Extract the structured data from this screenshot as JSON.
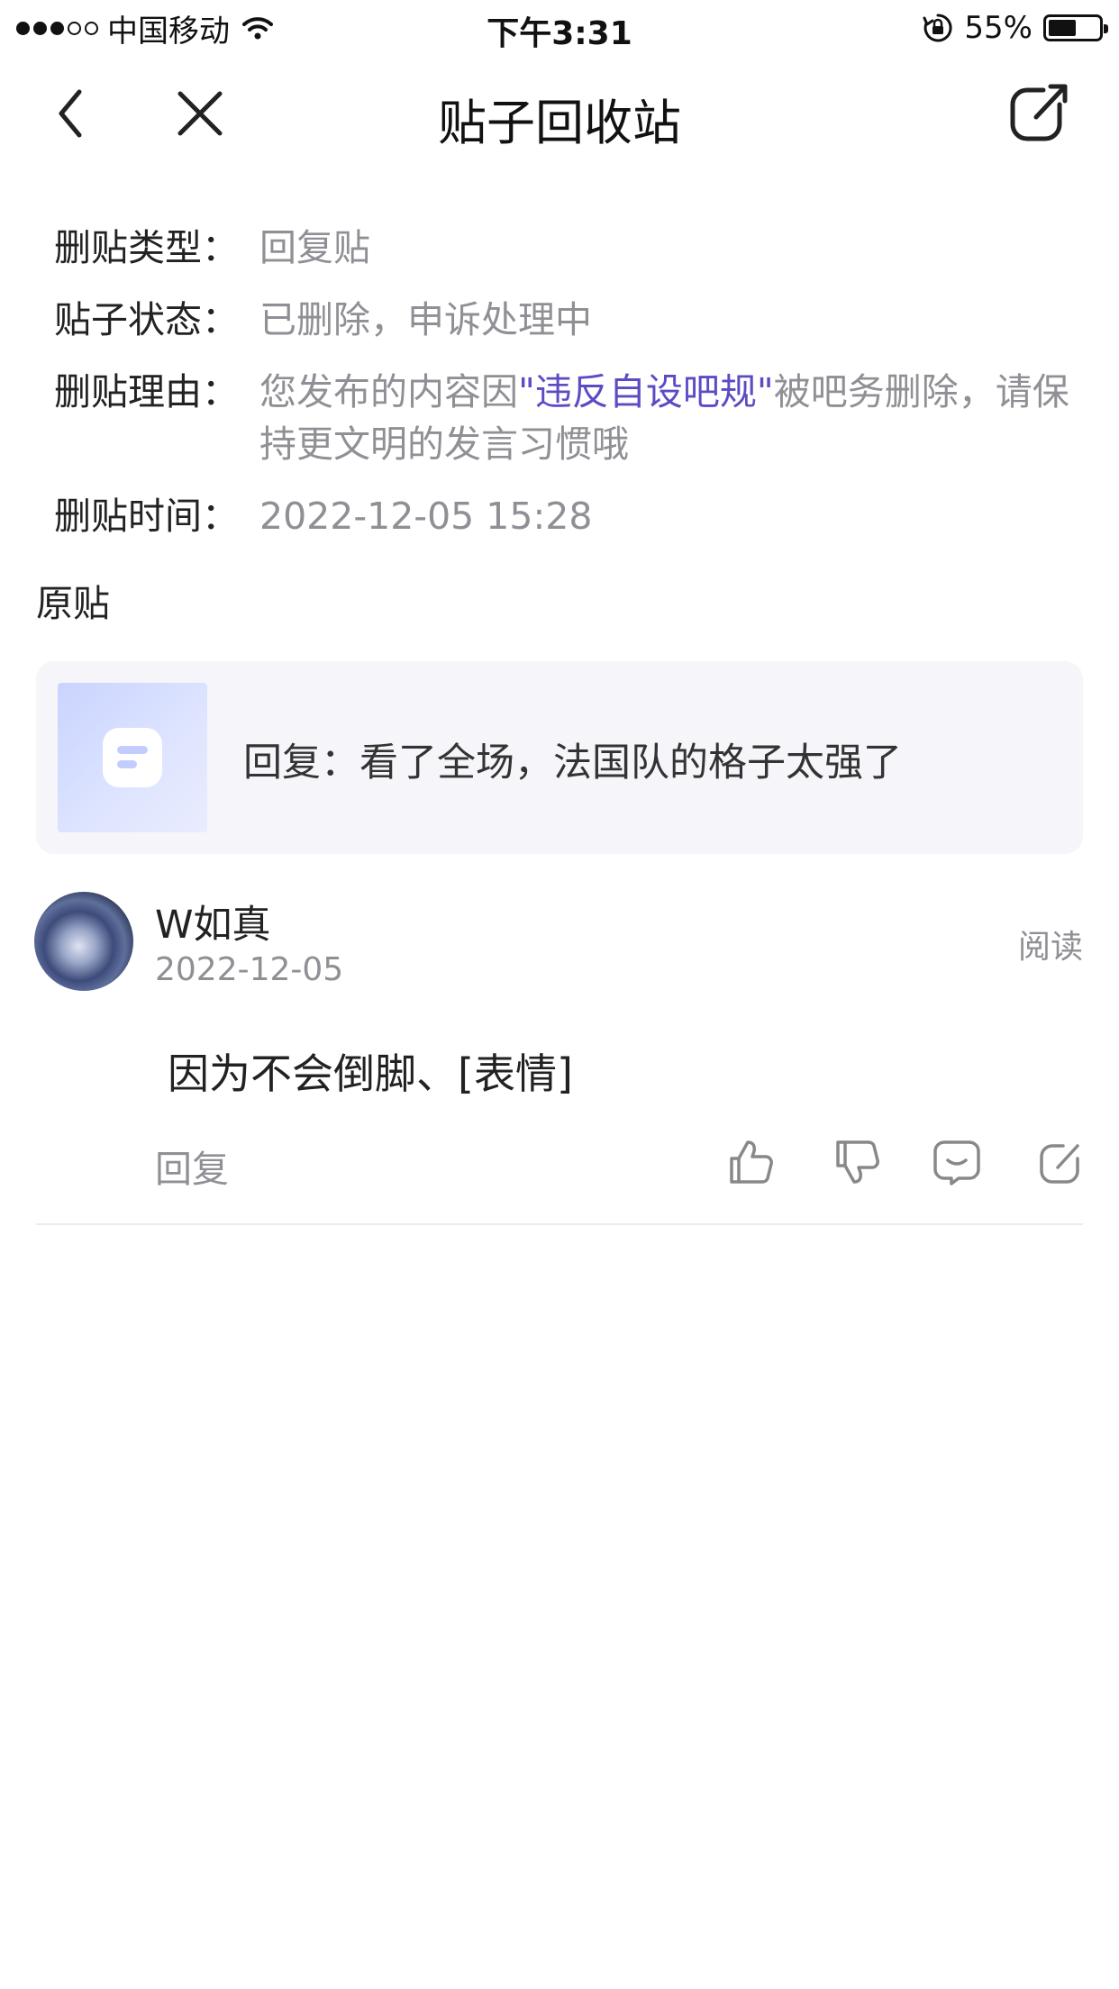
{
  "status_bar": {
    "carrier": "中国移动",
    "time": "下午3:31",
    "battery_percent": "55%",
    "battery_level": 0.55,
    "signal_bars_filled": 3,
    "signal_bars_total": 5,
    "icons": [
      "wifi-icon",
      "rotation-lock-icon",
      "battery-icon"
    ]
  },
  "navbar": {
    "title": "贴子回收站",
    "icons": [
      "back-icon",
      "close-icon",
      "share-icon"
    ]
  },
  "info": {
    "type_label": "删贴类型：",
    "type_value": "回复贴",
    "status_label": "贴子状态：",
    "status_value": "已删除，申诉处理中",
    "reason_label": "删贴理由：",
    "reason_prefix": "您发布的内容因",
    "reason_rule": "\"违反自设吧规\"",
    "reason_suffix": "被吧务删除，请保持更文明的发言习惯哦",
    "time_label": "删贴时间：",
    "time_value": "2022-12-05 15:28"
  },
  "original": {
    "section_title": "原贴",
    "text": "回复：看了全场，法国队的格子太强了"
  },
  "comment": {
    "username": "W如真",
    "date": "2022-12-05",
    "read_label": "阅读",
    "body": "因为不会倒脚、[表情]",
    "reply_label": "回复",
    "action_icons": [
      "thumbs-up-icon",
      "thumbs-down-icon",
      "comment-icon",
      "share-icon"
    ]
  },
  "colors": {
    "accent_link": "#5b4cc4",
    "muted_text": "#8f8f95",
    "card_bg": "#f5f5fa"
  }
}
